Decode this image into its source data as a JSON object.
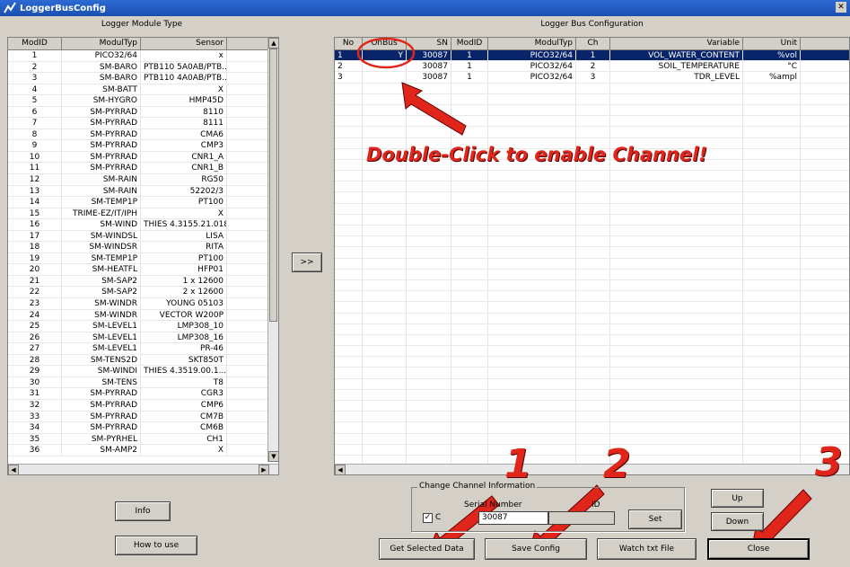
{
  "window": {
    "title": "LoggerBusConfig"
  },
  "left": {
    "title": "Logger Module Type",
    "headers": [
      "ModID",
      "ModulTyp",
      "Sensor"
    ],
    "rows": [
      [
        "1",
        "PICO32/64",
        "x"
      ],
      [
        "2",
        "SM-BARO",
        "PTB110 5A0AB/PTB..."
      ],
      [
        "3",
        "SM-BARO",
        "PTB110 4A0AB/PTB..."
      ],
      [
        "4",
        "SM-BATT",
        "X"
      ],
      [
        "5",
        "SM-HYGRO",
        "HMP45D"
      ],
      [
        "6",
        "SM-PYRRAD",
        "8110"
      ],
      [
        "7",
        "SM-PYRRAD",
        "8111"
      ],
      [
        "8",
        "SM-PYRRAD",
        "CMA6"
      ],
      [
        "9",
        "SM-PYRRAD",
        "CMP3"
      ],
      [
        "10",
        "SM-PYRRAD",
        "CNR1_A"
      ],
      [
        "11",
        "SM-PYRRAD",
        "CNR1_B"
      ],
      [
        "12",
        "SM-RAIN",
        "RG50"
      ],
      [
        "13",
        "SM-RAIN",
        "52202/3"
      ],
      [
        "14",
        "SM-TEMP1P",
        "PT100"
      ],
      [
        "15",
        "TRIME-EZ/IT/IPH",
        "X"
      ],
      [
        "16",
        "SM-WIND",
        "THIES 4.3155.21.018"
      ],
      [
        "17",
        "SM-WINDSL",
        "LISA"
      ],
      [
        "18",
        "SM-WINDSR",
        "RITA"
      ],
      [
        "19",
        "SM-TEMP1P",
        "PT100"
      ],
      [
        "20",
        "SM-HEATFL",
        "HFP01"
      ],
      [
        "21",
        "SM-SAP2",
        "1 x 12600"
      ],
      [
        "22",
        "SM-SAP2",
        "2 x 12600"
      ],
      [
        "23",
        "SM-WINDR",
        "YOUNG 05103"
      ],
      [
        "24",
        "SM-WINDR",
        "VECTOR W200P"
      ],
      [
        "25",
        "SM-LEVEL1",
        "LMP308_10"
      ],
      [
        "26",
        "SM-LEVEL1",
        "LMP308_16"
      ],
      [
        "27",
        "SM-LEVEL1",
        "PR-46"
      ],
      [
        "28",
        "SM-TENS2D",
        "SKT850T"
      ],
      [
        "29",
        "SM-WINDI",
        "THIES 4.3519.00.1..."
      ],
      [
        "30",
        "SM-TENS",
        "T8"
      ],
      [
        "31",
        "SM-PYRRAD",
        "CGR3"
      ],
      [
        "32",
        "SM-PYRRAD",
        "CMP6"
      ],
      [
        "33",
        "SM-PYRRAD",
        "CM7B"
      ],
      [
        "34",
        "SM-PYRRAD",
        "CM6B"
      ],
      [
        "35",
        "SM-PYRHEL",
        "CH1"
      ],
      [
        "36",
        "SM-AMP2",
        "X"
      ]
    ]
  },
  "transfer": {
    "label": ">>"
  },
  "right": {
    "title": "Logger Bus Configuration",
    "headers": [
      "No",
      "OnBus",
      "SN",
      "ModID",
      "ModulTyp",
      "Ch",
      "Variable",
      "Unit"
    ],
    "rows": [
      [
        "1",
        "Y",
        "30087",
        "1",
        "PICO32/64",
        "1",
        "VOL_WATER_CONTENT",
        "%vol"
      ],
      [
        "2",
        "",
        "30087",
        "1",
        "PICO32/64",
        "2",
        "SOIL_TEMPERATURE",
        "°C"
      ],
      [
        "3",
        "",
        "30087",
        "1",
        "PICO32/64",
        "3",
        "TDR_LEVEL",
        "%ampl"
      ]
    ]
  },
  "annotation": {
    "text": "Double-Click to enable Channel!",
    "n1": "1",
    "n2": "2",
    "n3": "3"
  },
  "group": {
    "title": "Change Channel Information",
    "serial_label": "Serial Number",
    "id_label": "ID",
    "serial_value": "30087",
    "checkbox_label": "C",
    "checked": true
  },
  "buttons": {
    "info": "Info",
    "howto": "How to use",
    "get": "Get Selected Data",
    "save": "Save Config",
    "watch": "Watch txt File",
    "close": "Close",
    "up": "Up",
    "down": "Down",
    "set": "Set"
  },
  "colors": {
    "selection": "#0a246a",
    "annotation": "#e0261b"
  }
}
